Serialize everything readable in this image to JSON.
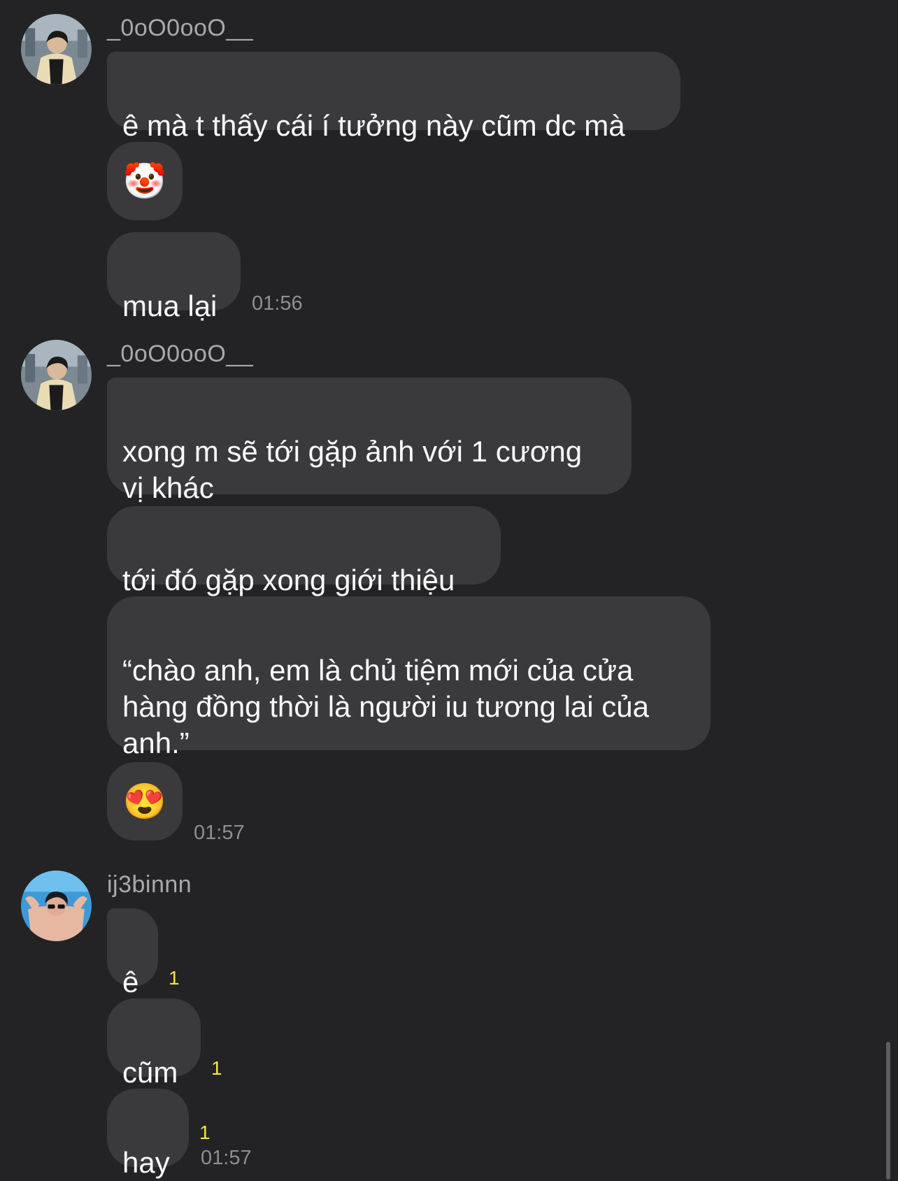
{
  "groups": [
    {
      "sender": "_0oO0ooO__",
      "messages": [
        "ê mà t thấy cái í tưởng này cũm dc mà",
        "🤡",
        "mua lại"
      ],
      "time": "01:56"
    },
    {
      "sender": "_0oO0ooO__",
      "messages": [
        "xong m sẽ tới gặp ảnh với 1 cương\nvị khác",
        "tới đó gặp xong giới thiệu",
        "“chào anh, em là chủ tiệm mới của cửa\nhàng đồng thời là người iu tương lai của\nanh.”",
        "😍"
      ],
      "time": "01:57"
    },
    {
      "sender": "ij3binnn",
      "messages": [
        "ê",
        "cũm",
        "hay"
      ],
      "unread": [
        "1",
        "1",
        "1"
      ],
      "time": "01:57"
    }
  ],
  "colors": {
    "background": "#232325",
    "bubble": "#3a3a3c",
    "sender_text": "#a9a9ad",
    "time_text": "#8e8e93",
    "unread_badge": "#f5e34a"
  },
  "icons": [
    "avatar-photo",
    "clown-face-emoji",
    "heart-eyes-emoji"
  ]
}
